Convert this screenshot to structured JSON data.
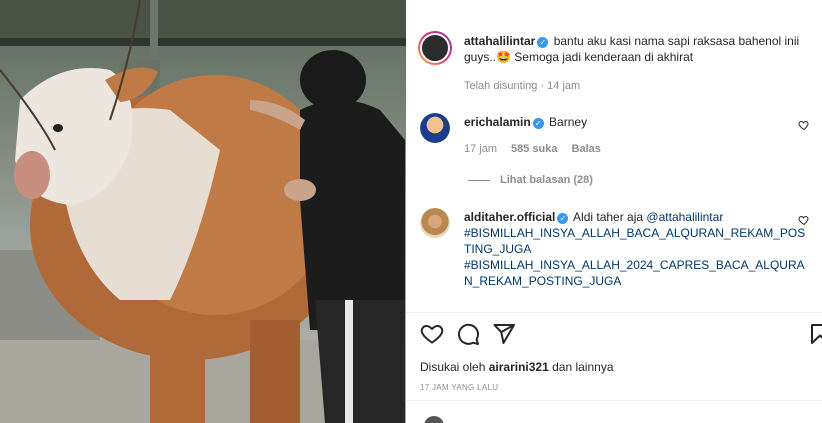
{
  "post": {
    "author": "attahalilintar",
    "caption": "bantu aku kasi nama sapi raksasa bahenol inii guys..🤩 Semoga jadi kenderaan di akhirat",
    "edited_label": "Telah disunting",
    "time": "14 jam"
  },
  "comments": [
    {
      "user": "erichalamin",
      "text": "Barney",
      "time": "17 jam",
      "likes": "585 suka",
      "reply": "Balas",
      "view_replies": "Lihat balasan (28)"
    },
    {
      "user": "alditaher.official",
      "text_prefix": "Aldi taher aja",
      "mention": "@attahalilintar",
      "hashtag1": "#BISMILLAH_INSYA_ALLAH_BACA_ALQURAN_REKAM_POSTING_JUGA",
      "hashtag2": "#BISMILLAH_INSYA_ALLAH_2024_CAPRES_BACA_ALQURAN_REKAM_POSTING_JUGA"
    }
  ],
  "footer": {
    "liked_by_prefix": "Disukai oleh",
    "liked_by_user": "airarini321",
    "liked_by_suffix": "dan lainnya",
    "time_ago": "17 JAM YANG LALU"
  },
  "icons": {
    "like": "heart-icon",
    "comment": "comment-icon",
    "share": "send-icon",
    "save": "bookmark-icon",
    "verified": "verified-badge-icon"
  },
  "colors": {
    "verified": "#3897f0",
    "link": "#00376b",
    "muted": "#8e8e8e"
  }
}
